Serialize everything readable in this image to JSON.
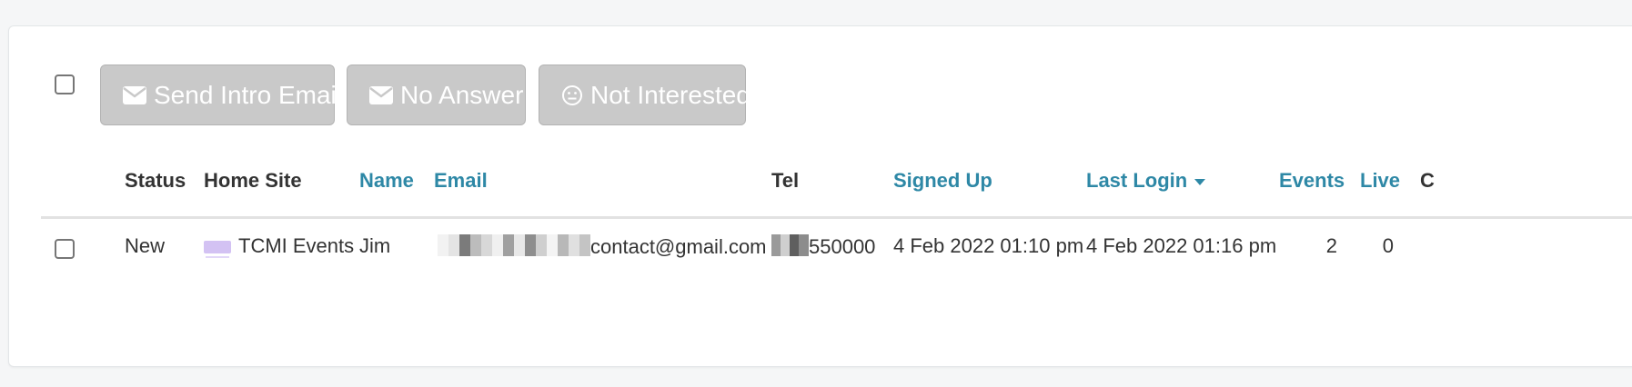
{
  "toolbar": {
    "send_intro_email_label": "Send Intro Email",
    "no_answer_label": "No Answer",
    "not_interested_label": "Not Interested"
  },
  "table": {
    "headers": {
      "status": "Status",
      "home_site": "Home Site",
      "name": "Name",
      "email": "Email",
      "tel": "Tel",
      "signed_up": "Signed Up",
      "last_login": "Last Login",
      "events": "Events",
      "live": "Live",
      "next": "C"
    },
    "rows": [
      {
        "status": "New",
        "home_site": "TCMI Events",
        "name": "Jim",
        "email_visible": "contact@gmail.com",
        "tel_visible": "550000",
        "signed_up": "4 Feb 2022 01:10 pm",
        "last_login": "4 Feb 2022 01:16 pm",
        "events": "2",
        "live": "0"
      }
    ]
  },
  "colors": {
    "link": "#2e88a6",
    "button_disabled": "#c9c9c9",
    "text": "#333333"
  },
  "icons": [
    "envelope-icon",
    "envelope-icon",
    "neutral-face-icon",
    "sort-desc-caret-icon",
    "site-logo-icon"
  ]
}
